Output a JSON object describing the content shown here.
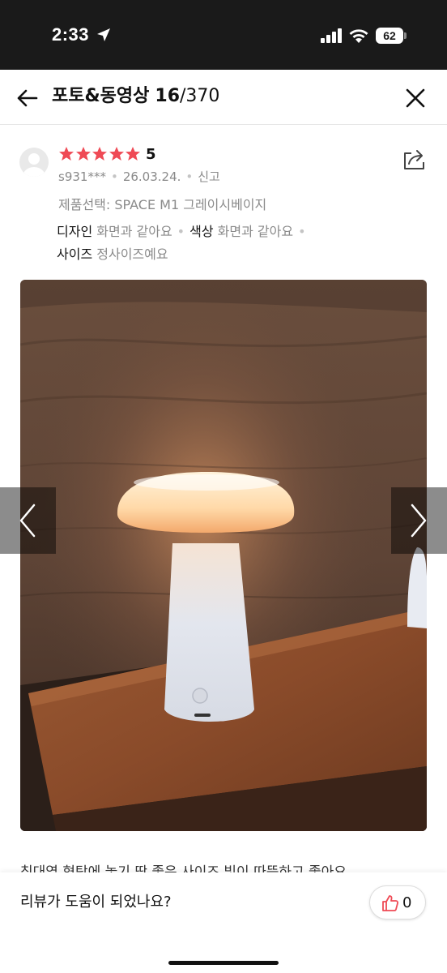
{
  "status": {
    "time": "2:33",
    "battery": "62"
  },
  "header": {
    "title": "포토&동영상",
    "current": "16",
    "total": "/370"
  },
  "review": {
    "rating": "5",
    "user": "s931***",
    "date": "26.03.24.",
    "report_label": "신고",
    "option": "제품선택: SPACE M1 그레이시베이지",
    "attributes": [
      {
        "key": "디자인",
        "value": "화면과 같아요"
      },
      {
        "key": "색상",
        "value": "화면과 같아요"
      },
      {
        "key": "사이즈",
        "value": "정사이즈예요"
      }
    ],
    "text": "침대옆 협탁에 놓기 딱 좋은 사이즈 빛이 따뜻하고 좋아요"
  },
  "footer": {
    "question": "리뷰가 도움이 되었나요?",
    "like_count": "0"
  },
  "colors": {
    "star": "#ef4a55",
    "like": "#ef4a55",
    "status_bg": "#1a1a1a"
  }
}
